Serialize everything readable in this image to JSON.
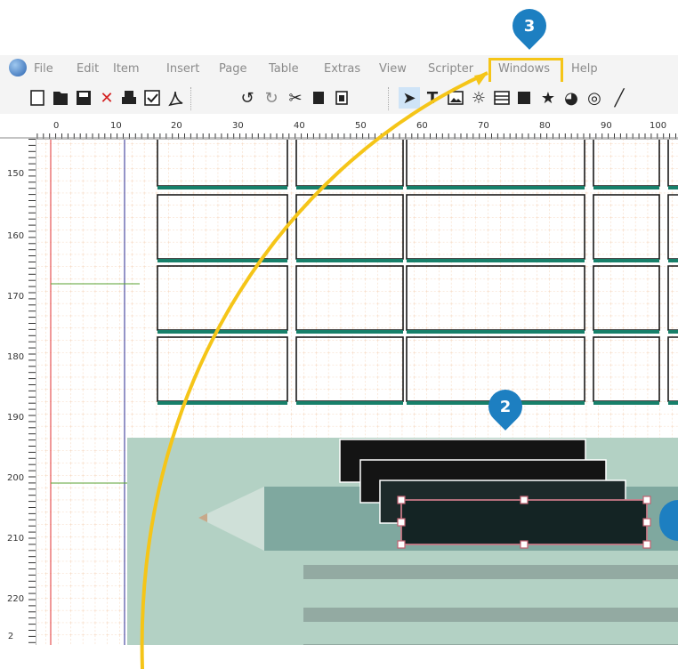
{
  "menu": {
    "items": [
      "File",
      "Edit",
      "Item",
      "Insert",
      "Page",
      "Table",
      "Extras",
      "View",
      "Scripter",
      "Windows",
      "Help"
    ]
  },
  "toolbar": {
    "icons": [
      "new-icon",
      "open-icon",
      "save-icon",
      "close-icon",
      "print-icon",
      "preflight-icon",
      "pdf-icon",
      "undo-icon",
      "redo-icon",
      "cut-icon",
      "copy-icon",
      "paste-icon",
      "select-icon",
      "text-frame-icon",
      "image-frame-icon",
      "render-frame-icon",
      "table-icon",
      "shape-icon",
      "polygon-icon",
      "arc-icon",
      "spiral-icon",
      "line-icon"
    ]
  },
  "rulers": {
    "horizontal": [
      "0",
      "10",
      "20",
      "30",
      "40",
      "50",
      "60",
      "70",
      "80",
      "90",
      "100"
    ],
    "vertical": [
      "150",
      "160",
      "170",
      "180",
      "190",
      "200",
      "210",
      "220",
      "2"
    ]
  },
  "callouts": {
    "menu_step": "3",
    "canvas_step": "2"
  },
  "colors": {
    "callout_blue": "#1d7fc1",
    "highlight_yellow": "#f5c518",
    "grid_line": "#f3c9a8",
    "frame_accent": "#17806a",
    "pencil_bg": "#b3d1c4",
    "pencil_body": "#7fa89f",
    "dark_bar": "#141414"
  }
}
